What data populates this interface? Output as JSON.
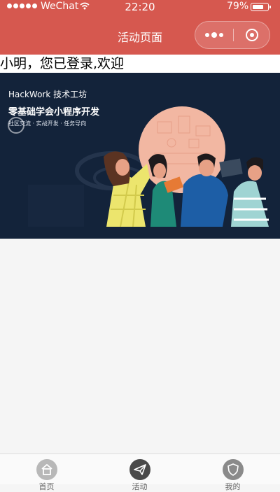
{
  "status_bar": {
    "carrier": "WeChat",
    "time": "22:20",
    "battery_percent_text": "79%",
    "battery_level": 0.79
  },
  "nav": {
    "title": "活动页面"
  },
  "welcome_text": "小明，您已登录,欢迎",
  "banner": {
    "line1": "HackWork 技术工坊",
    "line2": "零基础学会小程序开发",
    "line3": "社区交流 · 实战开发 · 任务导向"
  },
  "tabs": [
    {
      "label": "首页",
      "icon": "home-icon",
      "bg": "#b8b8b8"
    },
    {
      "label": "活动",
      "icon": "paper-plane-icon",
      "bg": "#4a4a4a"
    },
    {
      "label": "我的",
      "icon": "shield-icon",
      "bg": "#8a8a8a"
    }
  ],
  "colors": {
    "brand": "#d6584f",
    "banner_bg": "#13233a",
    "page_bg": "#f5f5f5"
  }
}
